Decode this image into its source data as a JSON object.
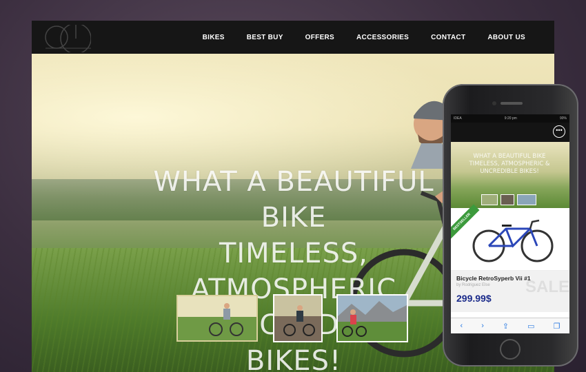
{
  "nav": {
    "items": [
      "BIKES",
      "BEST BUY",
      "OFFERS",
      "ACCESSORIES",
      "CONTACT",
      "ABOUT US"
    ]
  },
  "hero": {
    "headline_line1": "WHAT A BEAUTIFUL BIKE",
    "headline_line2": "TIMELESS, ATMOSPHERIC",
    "headline_line3": "& UNCREDIBLE BIKES!"
  },
  "phone": {
    "status_carrier": "IDEA",
    "status_time": "9:20 pm",
    "status_battery": "90%",
    "headline": "WHAT A BEAUTIFUL BIKE TIMELESS, ATMOSPHERIC & UNCREDIBLE BIKES!",
    "badge": "BESTSELLER",
    "product_name": "Bicycle RetroSyperb Vii #1",
    "product_by": "by Rodriguez Else",
    "price": "299.99$",
    "sale_text": "SALE",
    "menu_glyph": "•••"
  },
  "colors": {
    "nav_bg": "#161616",
    "price": "#1a2a8a",
    "badge": "#3c9a3c",
    "toolbar_icons": "#2a7ae2"
  },
  "icons": [
    "wheel-logo-icon",
    "more-options-icon",
    "back-icon",
    "forward-icon",
    "share-icon",
    "bookmarks-icon",
    "tabs-icon"
  ]
}
